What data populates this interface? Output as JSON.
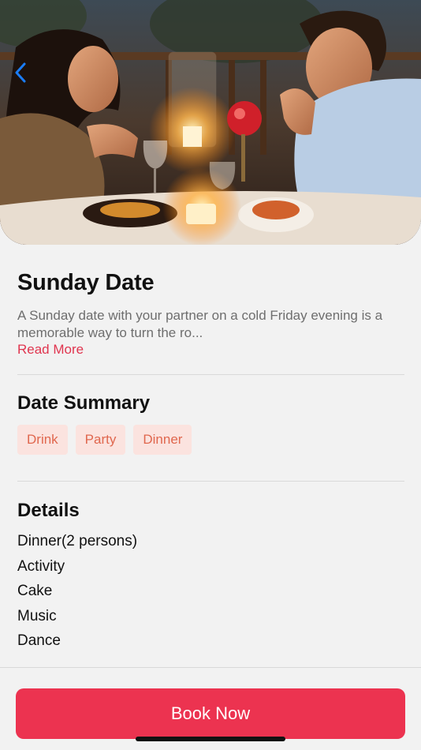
{
  "hero": {
    "image": "couple-candlelight-dinner-photo",
    "back_icon": "chevron-left-icon"
  },
  "date": {
    "title": "Sunday Date",
    "description": "A Sunday date with your partner on a cold Friday evening is a memorable way to turn the ro...",
    "read_more": "Read More"
  },
  "summary": {
    "heading": "Date Summary",
    "tags": [
      "Drink",
      "Party",
      "Dinner"
    ]
  },
  "details": {
    "heading": "Details",
    "items": [
      "Dinner(2 persons)",
      "Activity",
      "Cake",
      "Music",
      "Dance"
    ]
  },
  "actions": {
    "book_label": "Book Now"
  },
  "colors": {
    "accent": "#ec3350",
    "link": "#e0354f",
    "tag_bg": "#fbe3df",
    "tag_text": "#e0674e",
    "back": "#1a7cf5"
  }
}
